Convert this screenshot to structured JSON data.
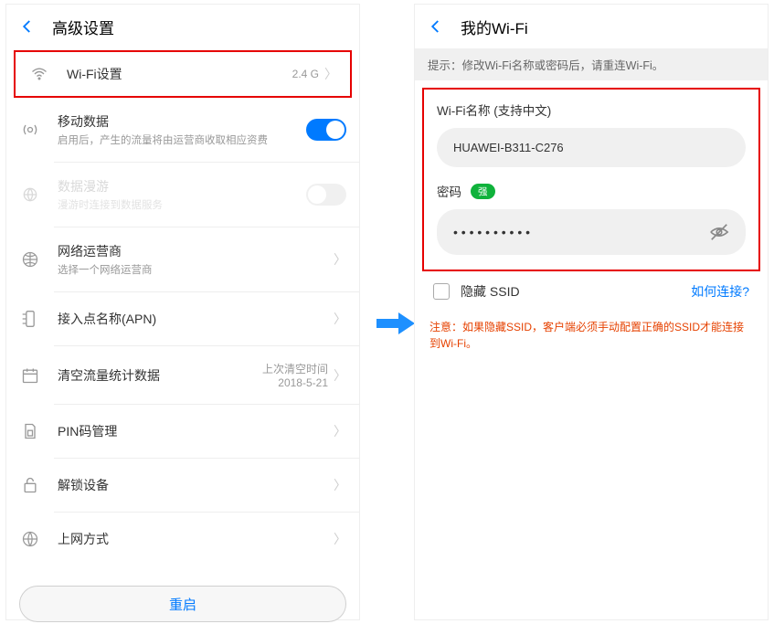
{
  "left": {
    "header": "高级设置",
    "items": [
      {
        "title": "Wi-Fi设置",
        "value": "2.4 G"
      },
      {
        "title": "移动数据",
        "sub": "启用后，产生的流量将由运营商收取相应资费"
      },
      {
        "title": "数据漫游",
        "sub": "漫游时连接到数据服务"
      },
      {
        "title": "网络运营商",
        "sub": "选择一个网络运营商"
      },
      {
        "title": "接入点名称(APN)"
      },
      {
        "title": "清空流量统计数据",
        "valueLabel": "上次清空时间",
        "value": "2018-5-21"
      },
      {
        "title": "PIN码管理"
      },
      {
        "title": "解锁设备"
      },
      {
        "title": "上网方式"
      }
    ],
    "restart": "重启"
  },
  "right": {
    "header": "我的Wi-Fi",
    "hint": "提示：修改Wi-Fi名称或密码后，请重连Wi-Fi。",
    "nameLabel": "Wi-Fi名称 (支持中文)",
    "nameValue": "HUAWEI-B311-C276",
    "pwdLabel": "密码",
    "pwdStrength": "强",
    "pwdValue": "• • • • • • • • • •",
    "hideSsid": "隐藏 SSID",
    "howConnect": "如何连接?",
    "warning": "注意：如果隐藏SSID，客户端必须手动配置正确的SSID才能连接到Wi-Fi。"
  }
}
